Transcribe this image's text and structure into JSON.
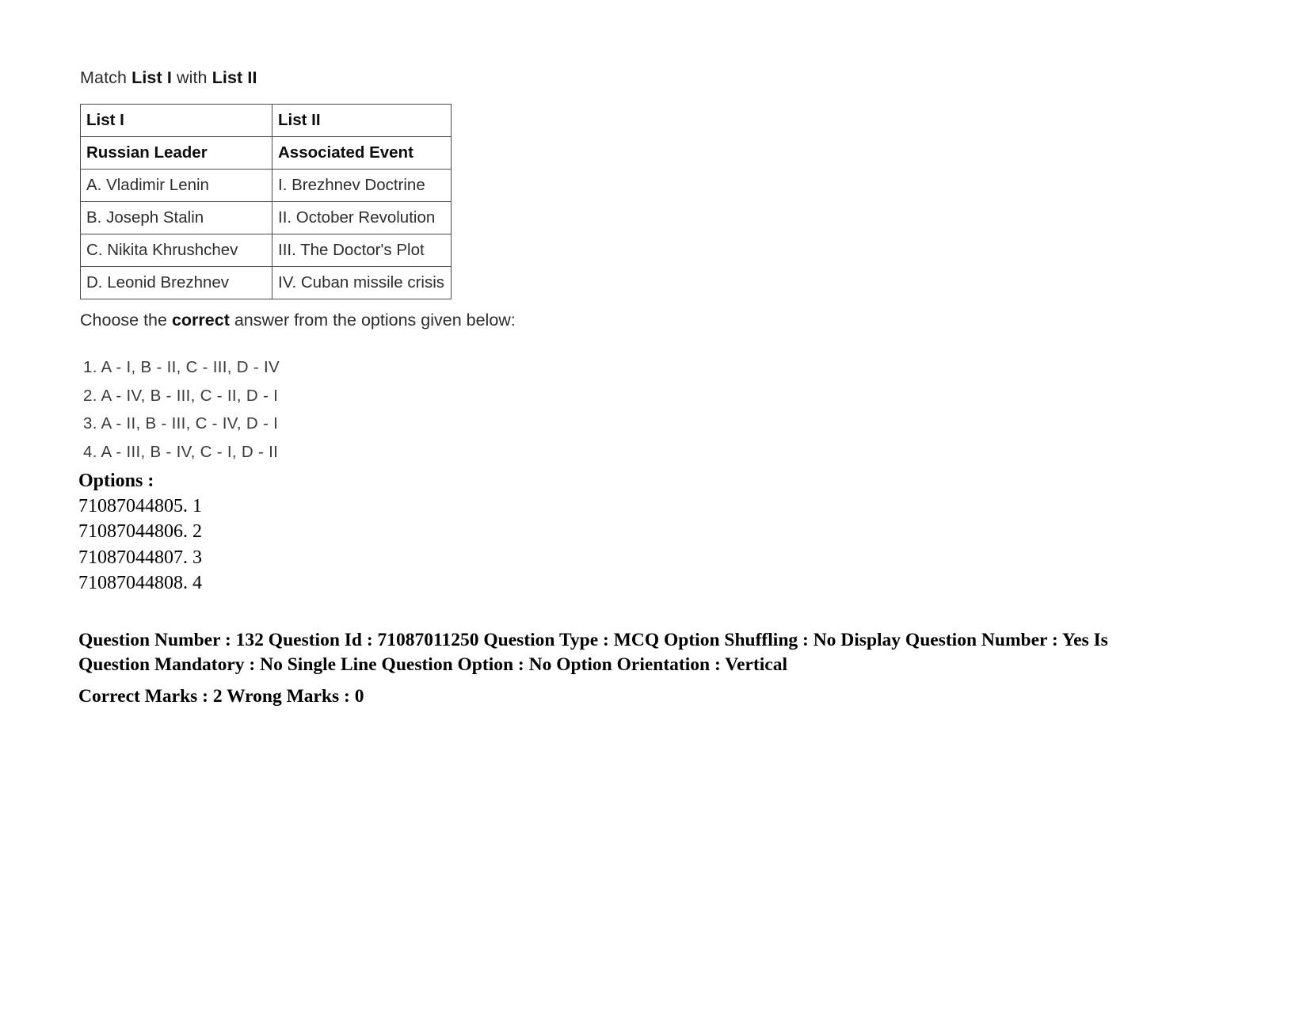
{
  "question": {
    "prompt_prefix": "Match ",
    "prompt_list1": "List I",
    "prompt_middle": " with ",
    "prompt_list2": "List II",
    "choose_prefix": "Choose the ",
    "choose_bold": "correct",
    "choose_suffix": " answer from the options given below:"
  },
  "table": {
    "header_row": {
      "col1": "List I",
      "col2": "List II"
    },
    "subheader_row": {
      "col1": "Russian Leader",
      "col2": "Associated Event"
    },
    "rows": [
      {
        "col1": "A. Vladimir Lenin",
        "col2": "I. Brezhnev Doctrine"
      },
      {
        "col1": "B. Joseph Stalin",
        "col2": "II. October Revolution"
      },
      {
        "col1": "C. Nikita Khrushchev",
        "col2": "III. The Doctor's Plot"
      },
      {
        "col1": "D.  Leonid Brezhnev",
        "col2": "IV. Cuban missile crisis"
      }
    ]
  },
  "answer_choices": [
    "1. A - I, B - II, C - III, D - IV",
    "2. A - IV, B - III, C - II, D - I",
    "3. A - II, B - III, C - IV, D - I",
    "4. A - III, B - IV, C - I, D - II"
  ],
  "options": {
    "label": "Options :",
    "items": [
      "71087044805. 1",
      "71087044806. 2",
      "71087044807. 3",
      "71087044808. 4"
    ]
  },
  "metadata": {
    "line1": "Question Number : 132 Question Id : 71087011250 Question Type : MCQ Option Shuffling : No Display Question Number : Yes Is",
    "line2": "Question Mandatory : No Single Line Question Option : No Option Orientation : Vertical",
    "marks_line": "Correct Marks : 2 Wrong Marks : 0"
  }
}
